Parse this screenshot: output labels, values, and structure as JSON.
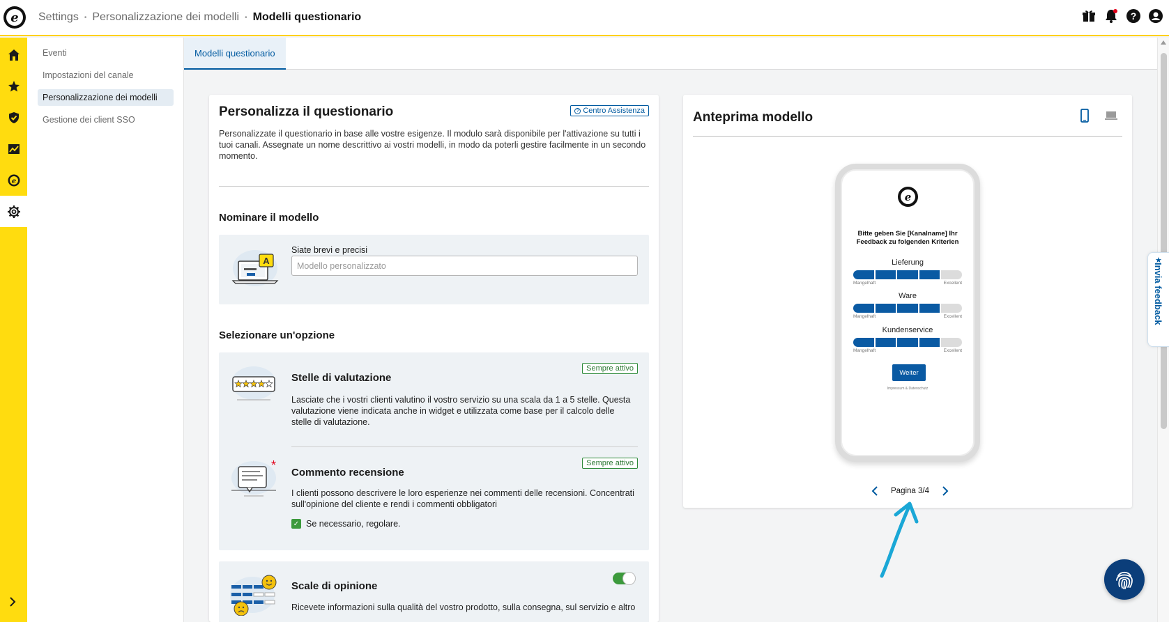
{
  "header": {
    "logo_letter": "e",
    "breadcrumb": [
      "Settings",
      "Personalizzazione dei modelli",
      "Modelli questionario"
    ],
    "icons": [
      "gift-icon",
      "bell-icon",
      "help-icon",
      "account-icon"
    ]
  },
  "rail": {
    "items": [
      "home-icon",
      "star-icon",
      "shield-icon",
      "chart-icon",
      "trusted-logo-icon",
      "gear-icon"
    ],
    "active": "gear-icon",
    "expand_icon": "chevron-right-icon"
  },
  "subnav": {
    "items": [
      {
        "label": "Eventi",
        "active": false
      },
      {
        "label": "Impostazioni del canale",
        "active": false
      },
      {
        "label": "Personalizzazione dei modelli",
        "active": true
      },
      {
        "label": "Gestione dei client SSO",
        "active": false
      }
    ]
  },
  "tabs": [
    {
      "label": "Modelli questionario",
      "active": true
    }
  ],
  "customize": {
    "title": "Personalizza il questionario",
    "help_label": "Centro Assistenza",
    "description": "Personalizzate il questionario in base alle vostre esigenze. Il modulo sarà disponibile per l'attivazione su tutti i tuoi canali. Assegnate un nome descrittivo ai vostri modelli, in modo da poterli gestire facilmente in un secondo momento.",
    "name_section_title": "Nominare il modello",
    "name_field_label": "Siate brevi e precisi",
    "name_field_value": "",
    "name_field_placeholder": "Modello personalizzato",
    "options_section_title": "Selezionare un'opzione",
    "options": [
      {
        "title": "Stelle di valutazione",
        "text": "Lasciate che i vostri clienti valutino il vostro servizio su una scala da 1 a 5 stelle. Questa valutazione viene indicata anche in widget e utilizzata come base per il calcolo delle stelle di valutazione.",
        "badge": "Sempre attivo"
      },
      {
        "title": "Commento recensione",
        "text": "I clienti possono descrivere le loro esperienze nei commenti delle recensioni. Concentrati sull'opinione del cliente e rendi i commenti obbligatori",
        "badge": "Sempre attivo",
        "checkbox_label": "Se necessario, regolare.",
        "checkbox_checked": true
      },
      {
        "title": "Scale di opinione",
        "text": "Ricevete informazioni sulla qualità del vostro prodotto, sulla consegna, sul servizio e altro",
        "toggle_on": true
      }
    ]
  },
  "preview": {
    "title": "Anteprima modello",
    "device_modes": [
      "mobile-icon",
      "desktop-icon"
    ],
    "active_device": "mobile-icon",
    "phone": {
      "heading": "Bitte geben Sie [Kanalname] Ihr Feedback zu folgenden Kriterien",
      "criteria": [
        {
          "label": "Lieferung",
          "filled": 4,
          "total": 5
        },
        {
          "label": "Ware",
          "filled": 4,
          "total": 5
        },
        {
          "label": "Kundenservice",
          "filled": 4,
          "total": 5
        }
      ],
      "scale_min": "Mangelhaft",
      "scale_max": "Excellent",
      "button": "Weiter",
      "footer": "Impressum & Datenschutz"
    },
    "pager": "Pagina 3/4"
  },
  "feedback_tab": "Invia feedback",
  "colors": {
    "brand_yellow": "#ffdc0f",
    "primary_blue": "#005aa0",
    "success_green": "#2e7a35",
    "annotation_cyan": "#1aa7d6"
  }
}
